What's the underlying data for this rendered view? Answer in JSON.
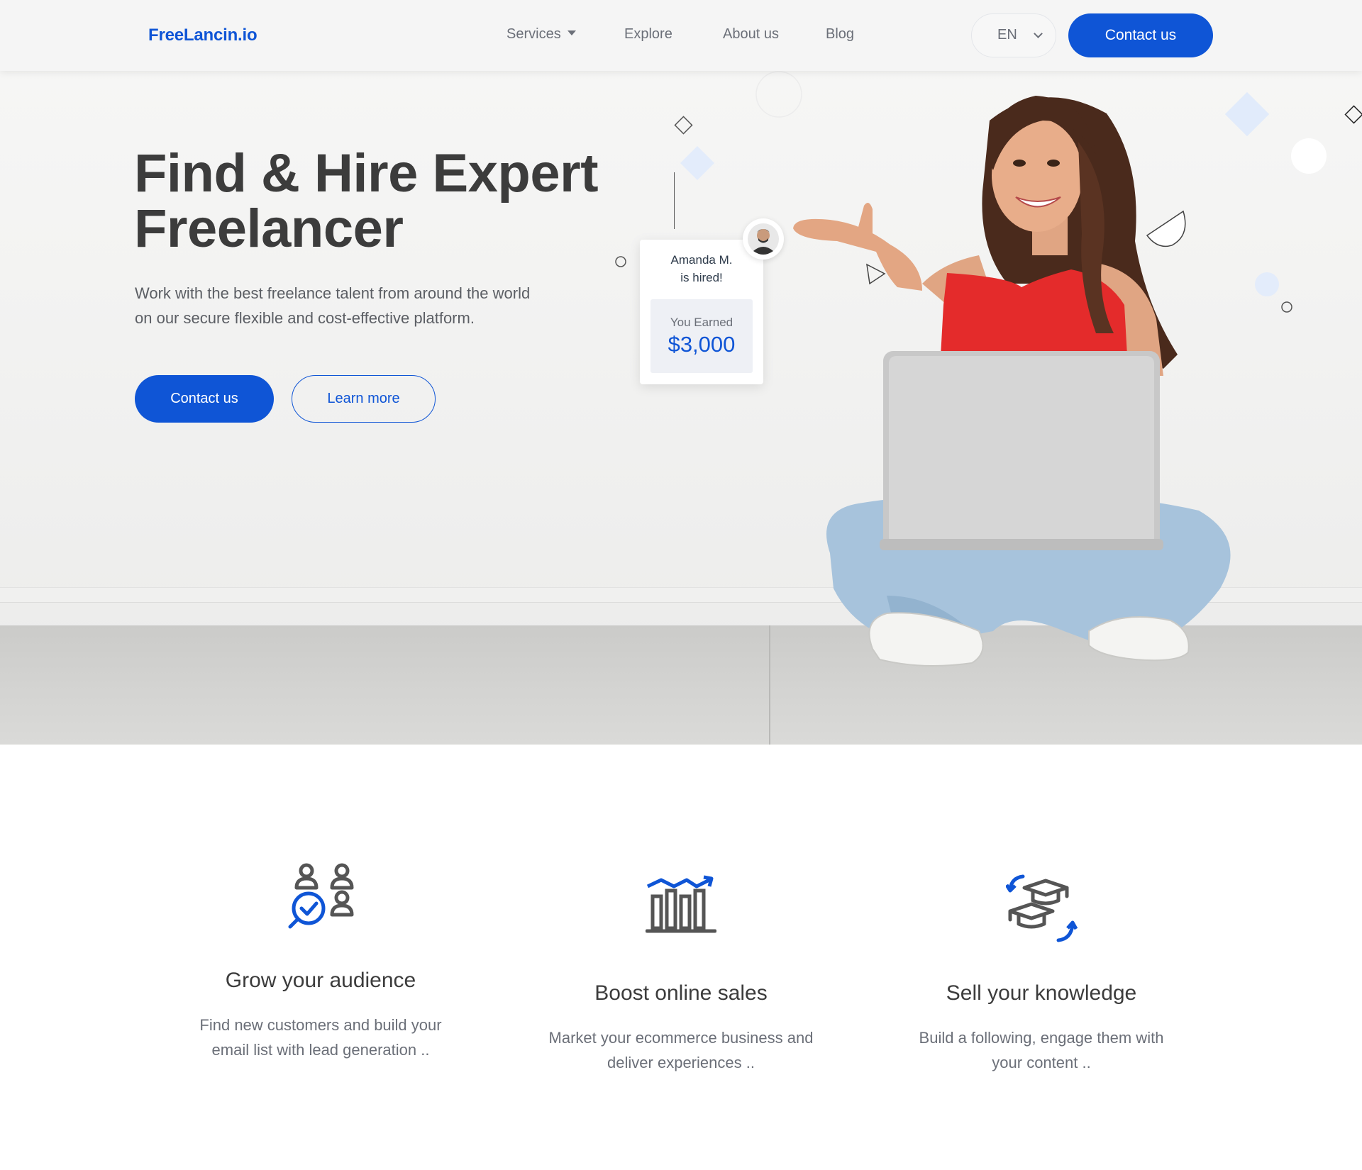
{
  "header": {
    "logo": "FreeLancin.io",
    "nav": {
      "services": "Services",
      "explore": "Explore",
      "about": "About us",
      "blog": "Blog"
    },
    "language": "EN",
    "contact_label": "Contact us"
  },
  "hero": {
    "title_line1": "Find & Hire Expert",
    "title_line2": "Freelancer",
    "subtitle": "Work with the best freelance talent from around the world on our secure flexible and cost-effective platform.",
    "contact_label": "Contact us",
    "learn_more_label": "Learn more",
    "hired_card": {
      "name_line1": "Amanda M.",
      "name_line2": "is hired!",
      "earned_label": "You Earned",
      "earned_value": "$3,000"
    }
  },
  "features": [
    {
      "icon": "audience-icon",
      "title": "Grow your audience",
      "description": "Find new customers and build your email list with lead generation .."
    },
    {
      "icon": "sales-chart-icon",
      "title": "Boost online sales",
      "description": "Market your ecommerce business and deliver experiences .."
    },
    {
      "icon": "graduation-cap-icon",
      "title": "Sell your knowledge",
      "description": "Build a following, engage them with your content .."
    }
  ],
  "colors": {
    "primary": "#0f55d6",
    "heading": "#3c3c3c",
    "muted_text": "#6b6f78",
    "header_bg": "#f5f5f5"
  }
}
